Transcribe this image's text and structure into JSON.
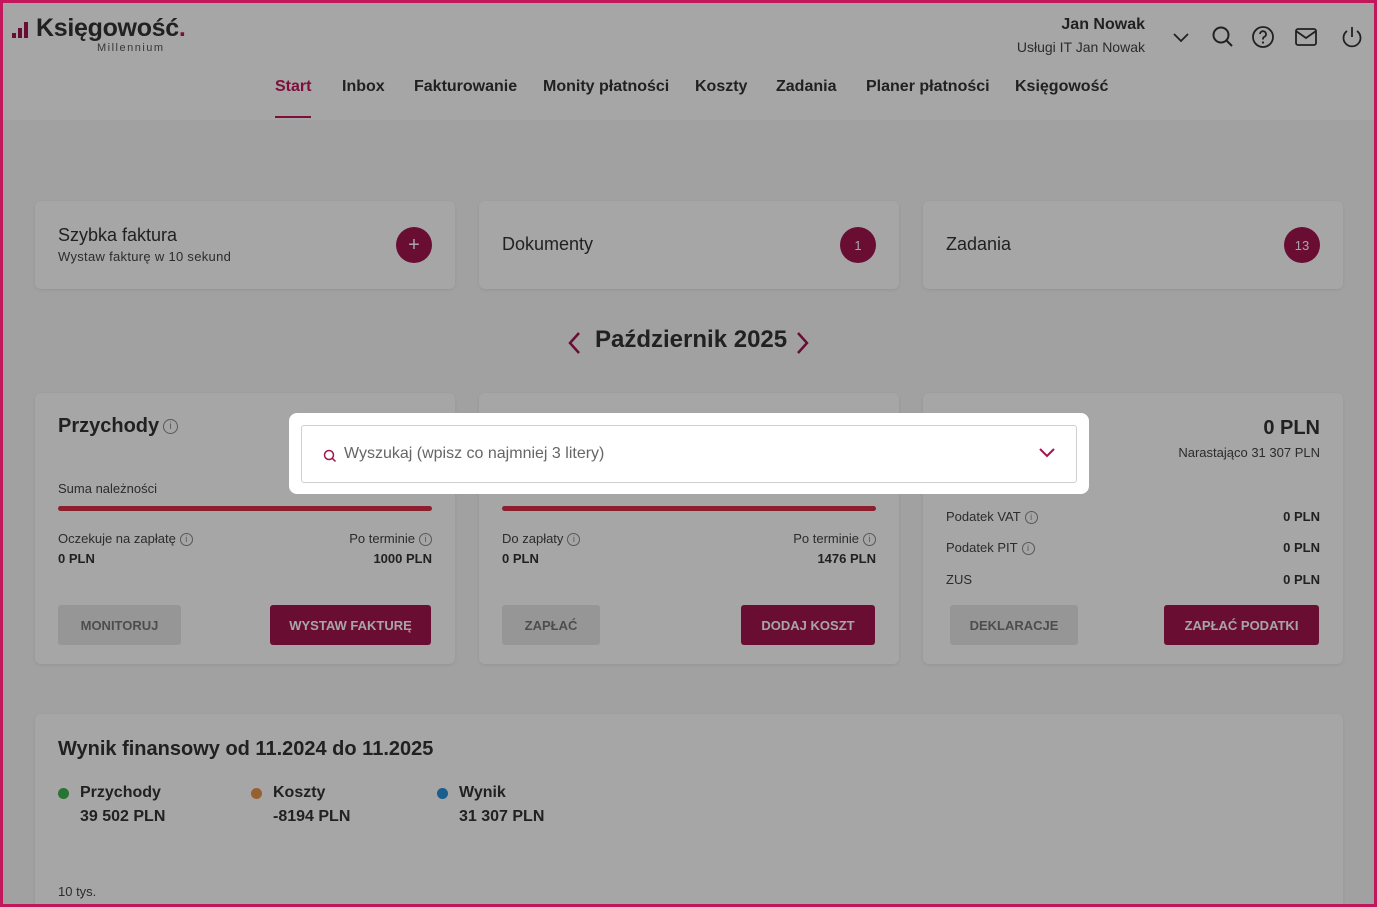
{
  "brand": {
    "name": "Księgowość",
    "dot": ".",
    "sub": "Millennium",
    "accent": "#a3154f"
  },
  "user": {
    "name": "Jan Nowak",
    "company": "Usługi IT Jan Nowak"
  },
  "icons": {
    "search": "search-icon",
    "help": "help-icon",
    "mail": "mail-icon",
    "power": "power-icon",
    "dropdown": "chevron-down-icon"
  },
  "nav": {
    "items": [
      {
        "label": "Start",
        "active": true
      },
      {
        "label": "Inbox"
      },
      {
        "label": "Fakturowanie"
      },
      {
        "label": "Monity płatności"
      },
      {
        "label": "Koszty"
      },
      {
        "label": "Zadania"
      },
      {
        "label": "Planer płatności"
      },
      {
        "label": "Księgowość"
      }
    ]
  },
  "quick": {
    "invoice": {
      "title": "Szybka faktura",
      "subtitle": "Wystaw fakturę w 10 sekund",
      "button": "+"
    },
    "documents": {
      "title": "Dokumenty",
      "badge": "1"
    },
    "tasks": {
      "title": "Zadania",
      "badge": "13"
    }
  },
  "month": {
    "label": "Październik 2025"
  },
  "income": {
    "title": "Przychody",
    "sum_label": "Suma należności",
    "waiting_label": "Oczekuje na zapłatę",
    "waiting_value": "0 PLN",
    "overdue_label": "Po terminie",
    "overdue_value": "1000 PLN",
    "btn_monitor": "MONITORUJ",
    "btn_invoice": "WYSTAW FAKTURĘ"
  },
  "costs": {
    "due_label": "Do zapłaty",
    "due_value": "0 PLN",
    "overdue_label": "Po terminie",
    "overdue_value": "1476 PLN",
    "btn_pay": "ZAPŁAĆ",
    "btn_add": "DODAJ KOSZT"
  },
  "taxes": {
    "total": "0 PLN",
    "cumulative": "Narastająco 31 307 PLN",
    "vat_label": "Podatek VAT",
    "vat_value": "0 PLN",
    "pit_label": "Podatek PIT",
    "pit_value": "0 PLN",
    "zus_label": "ZUS",
    "zus_value": "0 PLN",
    "btn_decl": "DEKLARACJE",
    "btn_pay": "ZAPŁAĆ PODATKI"
  },
  "finance": {
    "title": "Wynik finansowy od 11.2024 do 11.2025",
    "legend": [
      {
        "name": "Przychody",
        "value": "39 502 PLN",
        "color": "#3cb44b"
      },
      {
        "name": "Koszty",
        "value": "-8194 PLN",
        "color": "#e8944a"
      },
      {
        "name": "Wynik",
        "value": "31 307 PLN",
        "color": "#2a8fd6"
      }
    ],
    "axis_top": "10 tys."
  },
  "search": {
    "placeholder": "Wyszukaj (wpisz co najmniej 3 litery)"
  }
}
